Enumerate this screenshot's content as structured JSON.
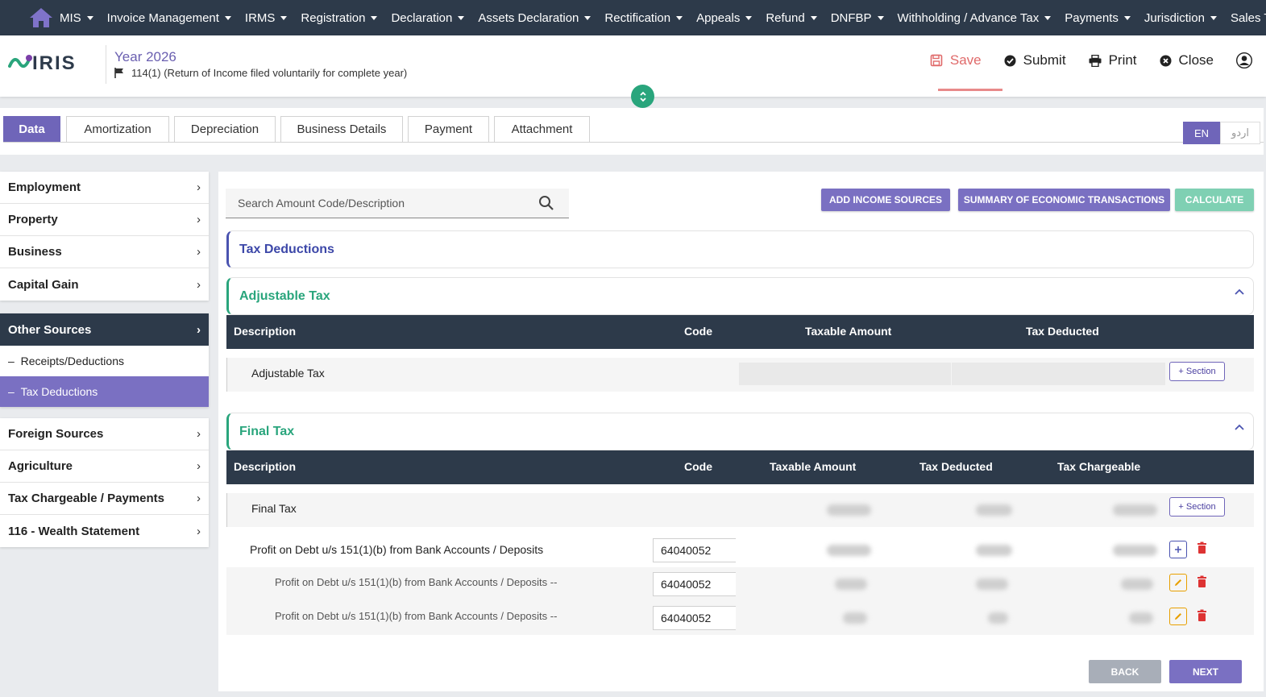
{
  "nav": {
    "items": [
      "MIS",
      "Invoice Management",
      "IRMS",
      "Registration",
      "Declaration",
      "Assets Declaration",
      "Rectification",
      "Appeals",
      "Refund",
      "DNFBP",
      "Withholding / Advance Tax",
      "Payments",
      "Jurisdiction",
      "Sales Tax"
    ]
  },
  "header": {
    "year": "Year 2026",
    "return_type": "114(1) (Return of Income filed voluntarily for complete year)",
    "logo_text": "IRIS",
    "save": "Save",
    "submit": "Submit",
    "print": "Print",
    "close": "Close"
  },
  "tabs": [
    "Data",
    "Amortization",
    "Depreciation",
    "Business Details",
    "Payment",
    "Attachment"
  ],
  "lang": {
    "en": "EN",
    "ur": "اردو"
  },
  "sidebar": {
    "group1": [
      "Employment",
      "Property",
      "Business",
      "Capital Gain"
    ],
    "active": "Other Sources",
    "subs": [
      "Receipts/Deductions",
      "Tax Deductions"
    ],
    "group2": [
      "Foreign Sources",
      "Agriculture",
      "Tax Chargeable / Payments",
      "116 - Wealth Statement"
    ]
  },
  "main": {
    "search_placeholder": "Search Amount Code/Description",
    "add_income": "ADD INCOME SOURCES",
    "summary": "SUMMARY OF ECONOMIC TRANSACTIONS",
    "calculate": "CALCULATE",
    "tax_deductions": "Tax Deductions",
    "adjustable": {
      "title": "Adjustable Tax",
      "headers": [
        "Description",
        "Code",
        "Taxable Amount",
        "Tax Deducted"
      ],
      "row": "Adjustable Tax",
      "section_btn": "+ Section"
    },
    "final": {
      "title": "Final Tax",
      "headers": [
        "Description",
        "Code",
        "Taxable Amount",
        "Tax Deducted",
        "Tax Chargeable"
      ],
      "row": "Final Tax",
      "section_btn": "+ Section",
      "items": [
        {
          "desc": "Profit on Debt u/s 151(1)(b) from Bank Accounts / Deposits",
          "code": "64040052"
        },
        {
          "desc": "Profit on Debt u/s 151(1)(b) from Bank Accounts / Deposits --",
          "code": "64040052"
        },
        {
          "desc": "Profit on Debt u/s 151(1)(b) from Bank Accounts / Deposits --",
          "code": "64040052"
        }
      ]
    },
    "back": "BACK",
    "next": "NEXT"
  },
  "colors": {
    "nav_bg": "#2d3a4a",
    "accent": "#6f65b9",
    "green": "#29a57c",
    "save_red": "#e06a6a",
    "calculate": "#7fd0b3",
    "back_grey": "#a8aeb8"
  }
}
